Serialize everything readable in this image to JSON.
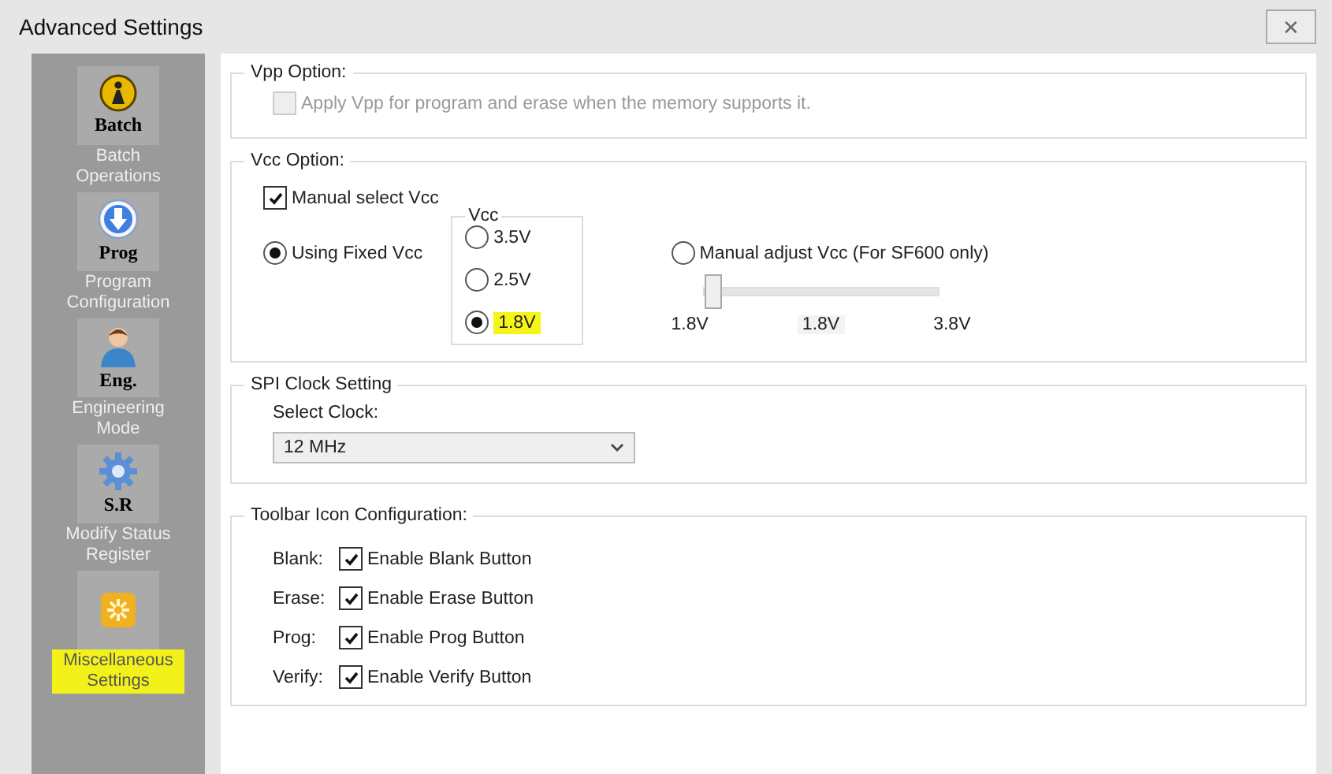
{
  "window": {
    "title": "Advanced Settings",
    "close": "✕"
  },
  "sidebar": {
    "items": [
      {
        "kind": "batch",
        "badge": "Batch",
        "label": "Batch Operations",
        "highlighted": false
      },
      {
        "kind": "prog",
        "badge": "Prog",
        "label": "Program Configuration",
        "highlighted": false
      },
      {
        "kind": "person",
        "badge": "Eng.",
        "label": "Engineering Mode",
        "highlighted": false
      },
      {
        "kind": "gear",
        "badge": "S.R",
        "label": "Modify Status Register",
        "highlighted": false
      },
      {
        "kind": "star",
        "label": "Miscellaneous Settings",
        "highlighted": true
      }
    ]
  },
  "vpp": {
    "title": "Vpp Option:",
    "checkbox": {
      "label": "Apply Vpp for program and erase when the memory supports it.",
      "checked": false,
      "disabled": true
    }
  },
  "vcc": {
    "title": "Vcc Option:",
    "manual_select": {
      "label": "Manual select Vcc",
      "checked": true
    },
    "fixed": {
      "label": "Using Fixed Vcc",
      "selected": true
    },
    "vcc_group": {
      "title": "Vcc",
      "options": [
        {
          "label": "3.5V",
          "selected": false,
          "highlighted": false
        },
        {
          "label": "2.5V",
          "selected": false,
          "highlighted": false
        },
        {
          "label": "1.8V",
          "selected": true,
          "highlighted": true
        }
      ]
    },
    "manual_adjust": {
      "label": "Manual adjust Vcc (For SF600 only)",
      "selected": false
    },
    "slider": {
      "level": 0,
      "min_label": "1.8V",
      "value_label": "1.8V",
      "max_label": "3.8V"
    }
  },
  "spi": {
    "title": "SPI Clock Setting",
    "select_label": "Select Clock:",
    "value": "12 MHz"
  },
  "toolbar": {
    "title": "Toolbar Icon Configuration:",
    "rows": [
      {
        "name": "Blank:",
        "label": "Enable Blank Button",
        "checked": true
      },
      {
        "name": "Erase:",
        "label": "Enable Erase Button",
        "checked": true
      },
      {
        "name": "Prog:",
        "label": "Enable Prog Button",
        "checked": true
      },
      {
        "name": "Verify:",
        "label": "Enable Verify Button",
        "checked": true
      }
    ]
  }
}
